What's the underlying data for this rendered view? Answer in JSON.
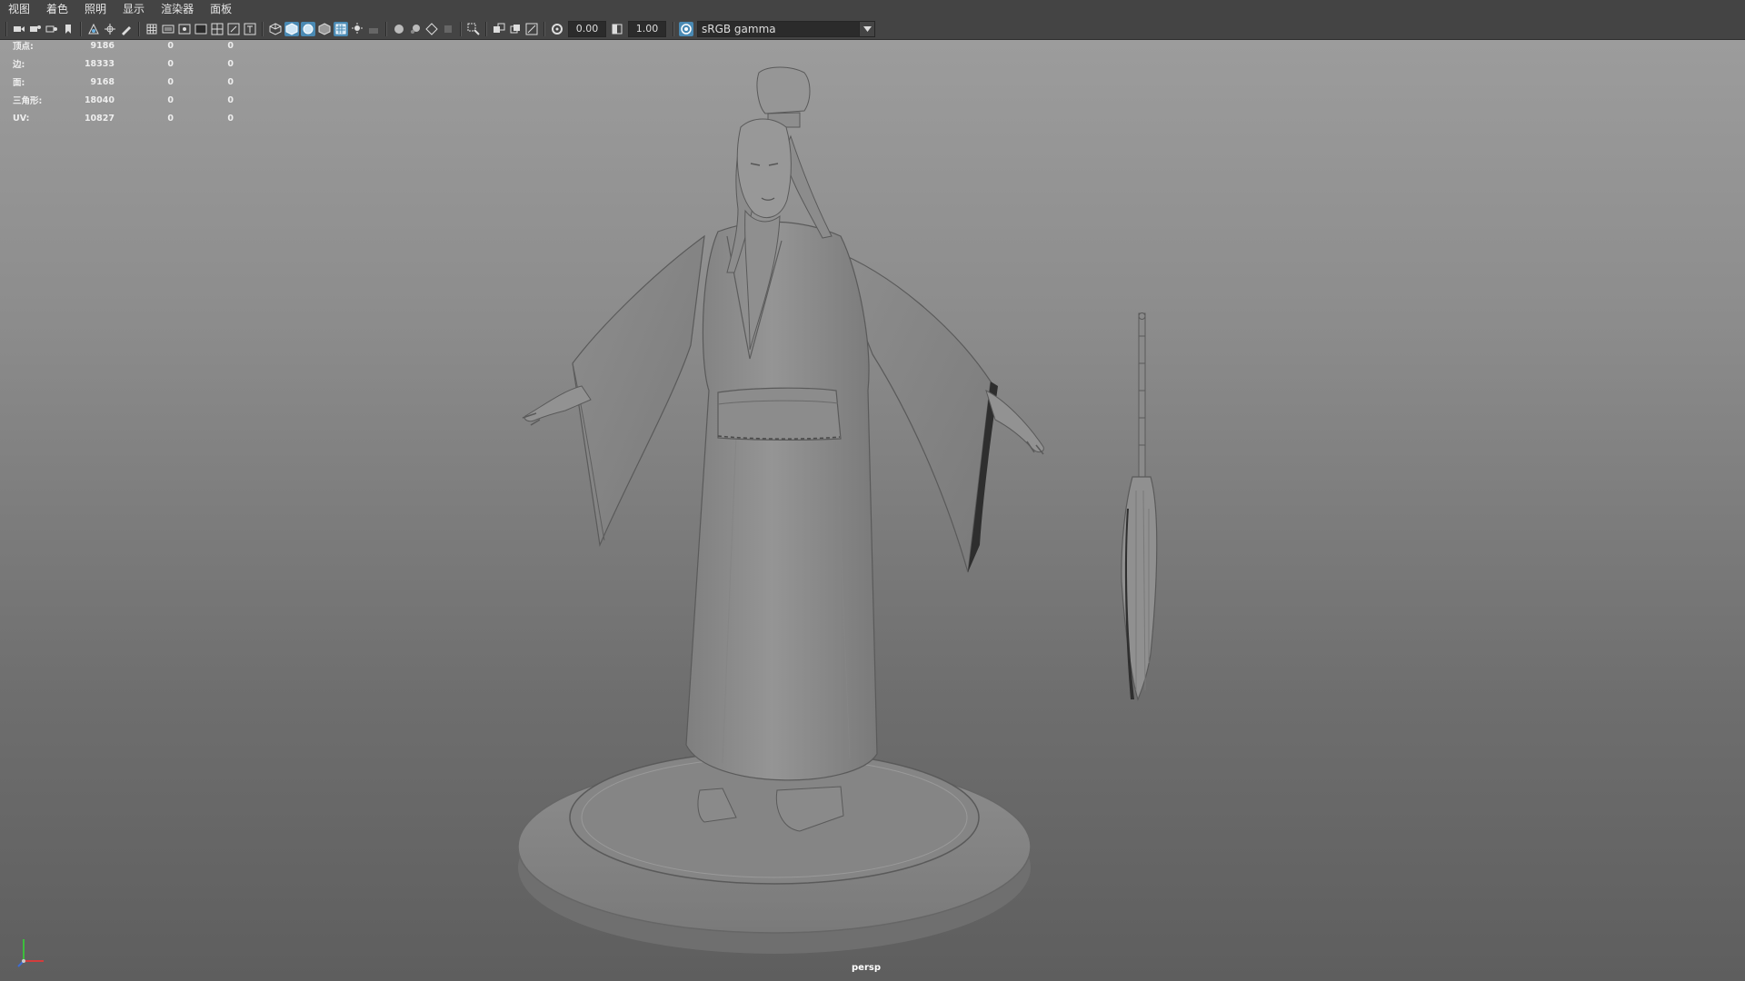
{
  "menu": [
    "视图",
    "着色",
    "照明",
    "显示",
    "渲染器",
    "面板"
  ],
  "toolbar": {
    "exposure": "0.00",
    "gamma": "1.00",
    "colorspace": "sRGB gamma",
    "icons": [
      "camera-icon",
      "camera-attrs-icon",
      "bookmark-icon",
      "image-plane-icon",
      "grid-icon",
      "film-gate-icon",
      "resolution-gate-icon",
      "gate-mask-icon",
      "field-chart-icon",
      "safe-action-icon",
      "safe-title-icon",
      "wireframe-icon",
      "smooth-shade-icon",
      "wireframe-on-shaded-icon",
      "textured-icon",
      "use-lights-icon",
      "shadows-icon",
      "xray-icon",
      "isolate-select-icon",
      "exposure-icon",
      "gamma-icon",
      "colorspace-icon"
    ]
  },
  "hud": {
    "rows": [
      {
        "label": "顶点:",
        "v1": "9186",
        "v2": "0",
        "v3": "0"
      },
      {
        "label": "边:",
        "v1": "18333",
        "v2": "0",
        "v3": "0"
      },
      {
        "label": "面:",
        "v1": "9168",
        "v2": "0",
        "v3": "0"
      },
      {
        "label": "三角形:",
        "v1": "18040",
        "v2": "0",
        "v3": "0"
      },
      {
        "label": "UV:",
        "v1": "10827",
        "v2": "0",
        "v3": "0"
      }
    ]
  },
  "camera_label": "persp",
  "colors": {
    "menubar": "#444444",
    "active_button": "#4a8ab4",
    "axis_x": "#d43c3c",
    "axis_y": "#3cbf3c",
    "axis_z": "#3c6cd4"
  }
}
